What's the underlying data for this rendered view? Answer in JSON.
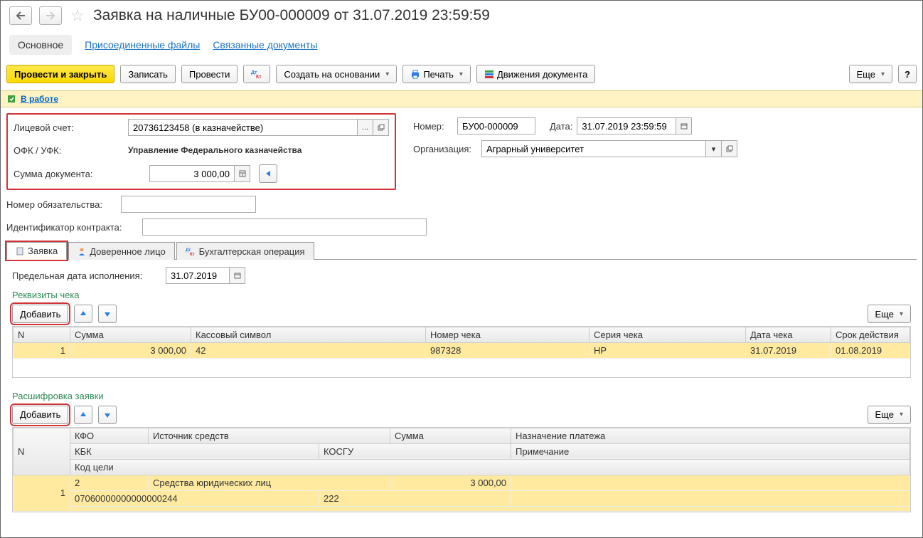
{
  "header": {
    "title": "Заявка на наличные БУ00-000009 от 31.07.2019 23:59:59"
  },
  "nav": {
    "main": "Основное",
    "attached": "Присоединенные файлы",
    "related": "Связанные документы"
  },
  "toolbar": {
    "post_close": "Провести и закрыть",
    "write": "Записать",
    "post": "Провести",
    "create_based": "Создать на основании",
    "print": "Печать",
    "movements": "Движения документа",
    "more": "Еще",
    "help": "?"
  },
  "status": {
    "label": "В работе"
  },
  "form": {
    "account_label": "Лицевой счет:",
    "account_value": "20736123458 (в казначействе)",
    "ofk_label": "ОФК / УФК:",
    "ofk_value": "Управление Федерального казначейства",
    "sum_label": "Сумма документа:",
    "sum_value": "3 000,00",
    "oblig_label": "Номер обязательства:",
    "oblig_value": "",
    "contract_label": "Идентификатор контракта:",
    "contract_value": "",
    "number_label": "Номер:",
    "number_value": "БУ00-000009",
    "date_label": "Дата:",
    "date_value": "31.07.2019 23:59:59",
    "org_label": "Организация:",
    "org_value": "Аграрный университет"
  },
  "tabs": {
    "request": "Заявка",
    "trustee": "Доверенное лицо",
    "acc_op": "Бухгалтерская операция"
  },
  "tab_content": {
    "deadline_label": "Предельная дата исполнения:",
    "deadline_value": "31.07.2019",
    "check_section": "Реквизиты чека",
    "add": "Добавить",
    "more": "Еще",
    "detail_section": "Расшифровка заявки"
  },
  "check_table": {
    "headers": {
      "n": "N",
      "sum": "Сумма",
      "symbol": "Кассовый символ",
      "num": "Номер чека",
      "series": "Серия чека",
      "date": "Дата чека",
      "valid": "Срок действия"
    },
    "rows": [
      {
        "n": "1",
        "sum": "3 000,00",
        "symbol": "42",
        "num": "987328",
        "series": "НР",
        "date": "31.07.2019",
        "valid": "01.08.2019"
      }
    ]
  },
  "detail_table": {
    "headers": {
      "n": "N",
      "kfo": "КФО",
      "source": "Источник средств",
      "sum": "Сумма",
      "purpose": "Назначение платежа",
      "kbk": "КБК",
      "kosgu": "КОСГУ",
      "note": "Примечание",
      "code": "Код цели"
    },
    "rows": [
      {
        "n": "1",
        "kfo": "2",
        "source": "Средства юридических лиц",
        "sum": "3 000,00",
        "purpose": "",
        "kbk": "07060000000000000244",
        "kosgu": "222",
        "note": "",
        "code": ""
      }
    ]
  }
}
